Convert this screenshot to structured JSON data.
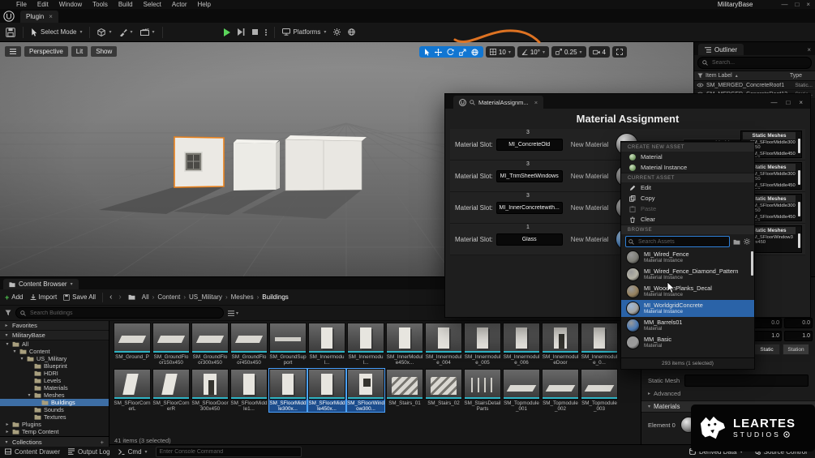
{
  "app": {
    "project": "MilitaryBase"
  },
  "menubar": {
    "items": [
      "File",
      "Edit",
      "Window",
      "Tools",
      "Build",
      "Select",
      "Actor",
      "Help"
    ]
  },
  "tabbar": {
    "plugin_tab": "Plugin"
  },
  "toolbar": {
    "select_mode": "Select Mode",
    "platforms": "Platforms"
  },
  "viewport": {
    "perspective": "Perspective",
    "lit": "Lit",
    "show": "Show",
    "grid_snap": "10",
    "angle_snap": "10°",
    "scale_snap": "0.25",
    "camera_speed": "4"
  },
  "outliner": {
    "title": "Outliner",
    "search_placeholder": "Search...",
    "columns": {
      "item_label": "Item Label",
      "type": "Type"
    },
    "rows": [
      {
        "label": "SM_MERGED_ConcreteRoof1",
        "type": "Static..."
      },
      {
        "label": "SM_MERGED_ConcreteRoof12",
        "type": "Static..."
      }
    ]
  },
  "material_dialog": {
    "tab_title": "MaterialAssignm...",
    "title": "Material Assignment",
    "slot_label": "Material Slot:",
    "new_material_label": "New Material",
    "static_meshes_label": "Static Meshes",
    "combo_value": "MI_WorldgridConcrete",
    "rows": [
      {
        "count": "3",
        "slot": "MI_ConcreteOld",
        "glass": false,
        "meshes": [
          "SM_SFloorMiddle300x450",
          "SM_SFloorMiddle450x450",
          "SM_SFloorWindow300x450"
        ]
      },
      {
        "count": "3",
        "slot": "MI_TrimSheetWindows",
        "glass": false,
        "meshes": [
          "SM_SFloorMiddle300x450",
          "SM_SFloorMiddle450x450",
          "SM_SFloorWindow300x450"
        ]
      },
      {
        "count": "3",
        "slot": "MI_InnerConcretewith...",
        "glass": false,
        "meshes": [
          "SM_SFloorMiddle300x450",
          "SM_SFloorMiddle450x450",
          "SM_SFloorWindow300x450"
        ]
      },
      {
        "count": "1",
        "slot": "Glass",
        "glass": true,
        "meshes": [
          "SM_SFloorWindow300x450"
        ]
      }
    ]
  },
  "asset_dropdown": {
    "section_create": "CREATE NEW ASSET",
    "section_current": "CURRENT ASSET",
    "section_browse": "BROWSE",
    "create_items": [
      "Material",
      "Material Instance"
    ],
    "current_items": [
      {
        "label": "Edit",
        "icon": "pencil-icon",
        "disabled": false
      },
      {
        "label": "Copy",
        "icon": "copy-icon",
        "disabled": false
      },
      {
        "label": "Paste",
        "icon": "paste-icon",
        "disabled": true
      },
      {
        "label": "Clear",
        "icon": "trash-icon",
        "disabled": false
      }
    ],
    "search_placeholder": "Search Assets",
    "assets": [
      {
        "name": "MI_Wired_Fence",
        "type": "Material Instance",
        "color": "#7d7d76",
        "selected": false
      },
      {
        "name": "MI_Wired_Fence_Diamond_Pattern",
        "type": "Material Instance",
        "color": "#b5b3a6",
        "selected": false
      },
      {
        "name": "MI_WoodenPlanks_Decal",
        "type": "Material Instance",
        "color": "#95805c",
        "selected": false
      },
      {
        "name": "MI_WorldgridConcrete",
        "type": "Material Instance",
        "color": "#a3a3a0",
        "selected": true
      },
      {
        "name": "MM_Barrels01",
        "type": "Material",
        "color": "#4a7ab5",
        "selected": false
      },
      {
        "name": "MM_Basic",
        "type": "Material",
        "color": "#9c9c9c",
        "selected": false
      }
    ],
    "footer": "293 items (1 selected)"
  },
  "details": {
    "fields_row1": [
      "0.0",
      "0.0"
    ],
    "fields_row2": [
      "1.0",
      "1.0"
    ],
    "mobility": [
      "Static",
      "Station"
    ],
    "static_mesh_label": "Static Mesh",
    "advanced_label": "Advanced",
    "materials_label": "Materials",
    "element_label": "Element 0"
  },
  "content_browser": {
    "tab": "Content Browser",
    "add_button": "Add",
    "import_button": "Import",
    "save_all_button": "Save All",
    "breadcrumb": [
      "All",
      "Content",
      "US_Military",
      "Meshes",
      "Buildings"
    ],
    "search_placeholder": "Search Buildings",
    "favorites_header": "Favorites",
    "project_header": "MilitaryBase",
    "collections_header": "Collections",
    "tree": [
      {
        "label": "All",
        "depth": 0,
        "caret": "open",
        "selected": false
      },
      {
        "label": "Content",
        "depth": 1,
        "caret": "open",
        "selected": false
      },
      {
        "label": "US_Military",
        "depth": 2,
        "caret": "open",
        "selected": false
      },
      {
        "label": "Blueprint",
        "depth": 3,
        "caret": "none",
        "selected": false
      },
      {
        "label": "HDRI",
        "depth": 3,
        "caret": "none",
        "selected": false
      },
      {
        "label": "Levels",
        "depth": 3,
        "caret": "none",
        "selected": false
      },
      {
        "label": "Materials",
        "depth": 3,
        "caret": "none",
        "selected": false
      },
      {
        "label": "Meshes",
        "depth": 3,
        "caret": "open",
        "selected": false
      },
      {
        "label": "Buildings",
        "depth": 4,
        "caret": "none",
        "selected": true
      },
      {
        "label": "Sounds",
        "depth": 3,
        "caret": "none",
        "selected": false
      },
      {
        "label": "Textures",
        "depth": 3,
        "caret": "none",
        "selected": false
      },
      {
        "label": "Plugins",
        "depth": 0,
        "caret": "closed",
        "selected": false
      },
      {
        "label": "Temp Content",
        "depth": 0,
        "caret": "closed",
        "selected": false
      }
    ],
    "asset_rows": [
      {
        "items": [
          {
            "name": "SM_Ground_P",
            "thumb": "slab",
            "selected": false
          },
          {
            "name": "SM_GroundFloor150x450",
            "thumb": "slab",
            "selected": false
          },
          {
            "name": "SM_GroundFloor300x450",
            "thumb": "slab",
            "selected": false
          },
          {
            "name": "SM_GroundFloor450x450",
            "thumb": "slab",
            "selected": false
          },
          {
            "name": "SM_GroundSupport",
            "thumb": "beam",
            "selected": false
          },
          {
            "name": "SM_Innermodul...",
            "thumb": "panel",
            "selected": false
          },
          {
            "name": "SM_Innermodul...",
            "thumb": "panel",
            "selected": false
          },
          {
            "name": "SM_InnerModule450x...",
            "thumb": "panel",
            "selected": false
          },
          {
            "name": "SM_Innermodule_004",
            "thumb": "panel",
            "selected": false
          },
          {
            "name": "SM_Innermodule_005",
            "thumb": "panel",
            "selected": false
          },
          {
            "name": "SM_Innermodule_006",
            "thumb": "panel",
            "selected": false
          },
          {
            "name": "SM_InnermoduleDoor",
            "thumb": "door",
            "selected": false
          },
          {
            "name": "SM_Innermodule_0...",
            "thumb": "panel",
            "selected": false
          }
        ]
      },
      {
        "items": [
          {
            "name": "SM_SFloorCornerL",
            "thumb": "corner",
            "selected": false
          },
          {
            "name": "SM_SFloorCornerR",
            "thumb": "corner",
            "selected": false
          },
          {
            "name": "SM_SFloorDoor300x450",
            "thumb": "door",
            "selected": false
          },
          {
            "name": "SM_SFloorMiddle1...",
            "thumb": "panel",
            "selected": false
          },
          {
            "name": "SM_SFloorMiddle300x...",
            "thumb": "panel",
            "selected": true
          },
          {
            "name": "SM_SFloorMiddle450x...",
            "thumb": "panel",
            "selected": true
          },
          {
            "name": "SM_SFloorWindow300...",
            "thumb": "window",
            "selected": true
          },
          {
            "name": "SM_Stairs_01",
            "thumb": "stairs",
            "selected": false
          },
          {
            "name": "SM_Stairs_02",
            "thumb": "stairs",
            "selected": false
          },
          {
            "name": "SM_StairsDetailParts",
            "thumb": "rail",
            "selected": false
          },
          {
            "name": "SM_Topmodule_001",
            "thumb": "flat",
            "selected": false
          },
          {
            "name": "SM_Topmodule_002",
            "thumb": "flat",
            "selected": false
          },
          {
            "name": "SM_Topmodule_003",
            "thumb": "flat",
            "selected": false
          }
        ]
      }
    ],
    "status": "41 items (3 selected)"
  },
  "statusbar": {
    "content_drawer": "Content Drawer",
    "output_log": "Output Log",
    "cmd": "Cmd",
    "console_placeholder": "Enter Console Command",
    "derived_data": "Derived Data",
    "source_control": "Source Control"
  },
  "watermark": {
    "line1": "LEARTES",
    "line2": "STUDIOS"
  }
}
